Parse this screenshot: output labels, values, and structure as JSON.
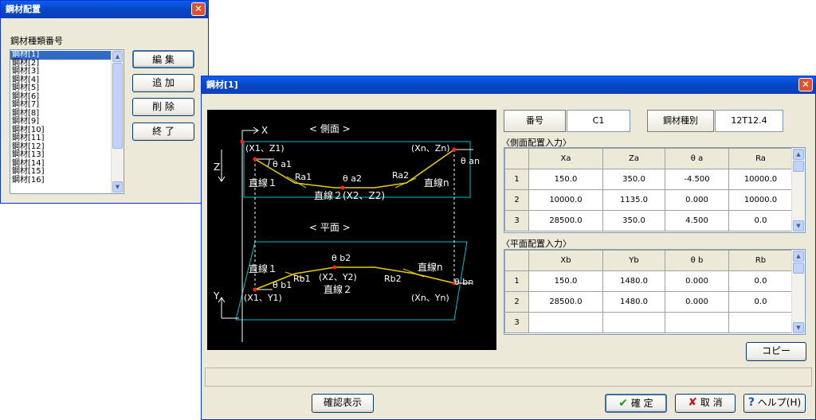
{
  "win1": {
    "title": "鋼材配置",
    "list_label": "鋼材種類番号",
    "items": [
      "鋼材[1]",
      "鋼材[2]",
      "鋼材[3]",
      "鋼材[4]",
      "鋼材[5]",
      "鋼材[6]",
      "鋼材[7]",
      "鋼材[8]",
      "鋼材[9]",
      "鋼材[10]",
      "鋼材[11]",
      "鋼材[12]",
      "鋼材[13]",
      "鋼材[14]",
      "鋼材[15]",
      "鋼材[16]"
    ],
    "buttons": {
      "edit": "編 集",
      "add": "追 加",
      "delete": "削 除",
      "end": "終 了"
    }
  },
  "win2": {
    "title": "鋼材[1]",
    "number_label": "番号",
    "number_value": "C1",
    "type_label": "鋼材種別",
    "type_value": "12T12.4",
    "side_section": "〈側面配置入力〉",
    "side_columns": [
      "Xa",
      "Za",
      "θ a",
      "Ra"
    ],
    "side_rows": [
      [
        "1",
        "150.0",
        "350.0",
        "-4.500",
        "10000.0"
      ],
      [
        "2",
        "10000.0",
        "1135.0",
        "0.000",
        "10000.0"
      ],
      [
        "3",
        "28500.0",
        "350.0",
        "4.500",
        "0.0"
      ]
    ],
    "plan_section": "〈平面配置入力〉",
    "plan_columns": [
      "Xb",
      "Yb",
      "θ b",
      "Rb"
    ],
    "plan_rows": [
      [
        "1",
        "150.0",
        "1480.0",
        "0.000",
        "0.0"
      ],
      [
        "2",
        "28500.0",
        "1480.0",
        "0.000",
        "0.0"
      ],
      [
        "3",
        "",
        "",
        "",
        ""
      ]
    ],
    "copy_button": "コピー",
    "confirm_display_button": "確認表示",
    "ok_button": "確 定",
    "cancel_button": "取 消",
    "help_button": "ヘルプ(H)"
  },
  "diagram": {
    "side_title": "< 側面 >",
    "plan_title": "< 平面 >",
    "x_axis": "X",
    "z_axis": "Z",
    "y_axis": "Y",
    "side_labels": {
      "p1": "(X1、Z1)",
      "pn": "(Xn、Zn)",
      "ta1": "θ a1",
      "tan": "θ an",
      "ra1": "Ra1",
      "ta2": "θ a2",
      "ra2": "Ra2",
      "line1": "直線１",
      "line2": "直線２(X2、Z2)",
      "linen": "直線n"
    },
    "plan_labels": {
      "tb2": "θ b2",
      "line1": "直線１",
      "linen": "直線n",
      "tb1": "θ b1",
      "rb1": "Rb1",
      "p2": "(X2、Y2)",
      "rb2": "Rb2",
      "tbn": "θ bn",
      "p1": "(X1、Y1)",
      "line2": "直線２",
      "pn": "(Xn、Yn)"
    }
  }
}
